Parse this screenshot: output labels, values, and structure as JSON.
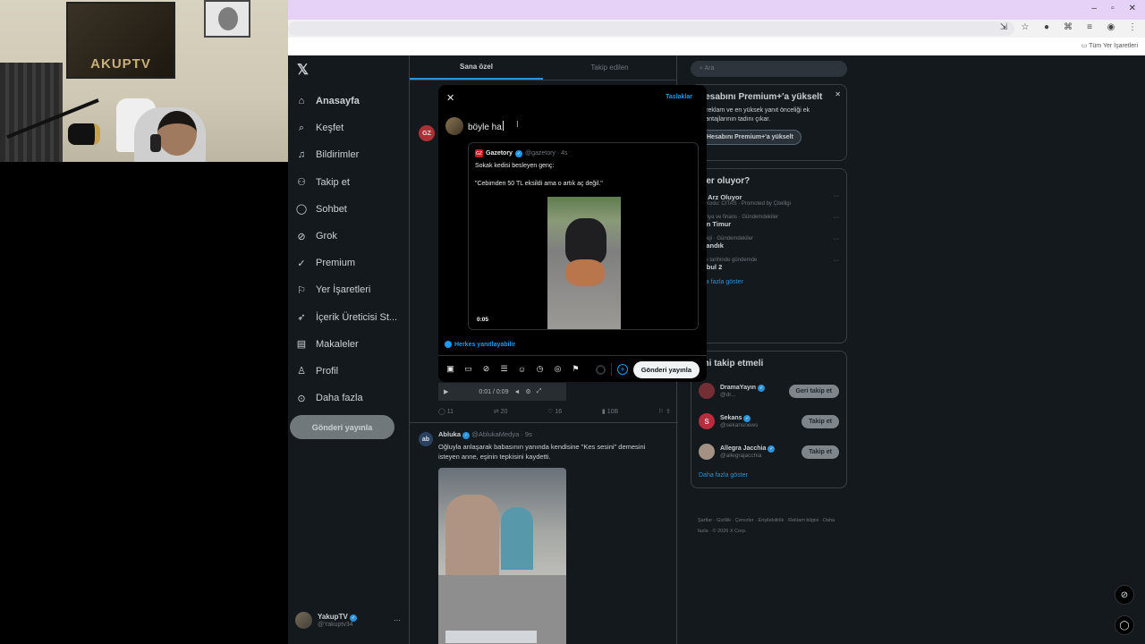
{
  "webcam": {
    "poster_text": "AKUPTV"
  },
  "window": {
    "minimize": "–",
    "maximize": "▫",
    "close": "✕"
  },
  "bookmarks": {
    "all_label": "Tüm Yer İşaretleri"
  },
  "sidebar": {
    "items": [
      {
        "label": "Anasayfa",
        "icon": "home-icon"
      },
      {
        "label": "Keşfet",
        "icon": "search-icon"
      },
      {
        "label": "Bildirimler",
        "icon": "bell-icon"
      },
      {
        "label": "Takip et",
        "icon": "follow-icon"
      },
      {
        "label": "Sohbet",
        "icon": "chat-icon"
      },
      {
        "label": "Grok",
        "icon": "grok-icon"
      },
      {
        "label": "Premium",
        "icon": "premium-icon"
      },
      {
        "label": "Yer İşaretleri",
        "icon": "bookmark-icon"
      },
      {
        "label": "İçerik Üreticisi St...",
        "icon": "rocket-icon"
      },
      {
        "label": "Makaleler",
        "icon": "article-icon"
      },
      {
        "label": "Profil",
        "icon": "profile-icon"
      },
      {
        "label": "Daha fazla",
        "icon": "more-icon"
      }
    ],
    "post_button": "Gönderi yayınla",
    "account": {
      "name": "YakupTV",
      "handle": "@Yakuptv34"
    }
  },
  "main": {
    "tabs": [
      "Sana özel",
      "Takip edilen"
    ],
    "video_time": "0:01 / 0:09",
    "actions": [
      "11",
      "20",
      "16",
      "10B"
    ],
    "post2": {
      "name": "Abluka",
      "handle": "@AblukaMedya · 9s",
      "text": "Oğluyla anlaşarak babasının yanında kendisine \"Kes sesini\" demesini isteyen anne, eşinin tepkisini kaydetti."
    }
  },
  "modal": {
    "drafts": "Taslaklar",
    "text": "böyle ha",
    "quote": {
      "name": "Gazetory",
      "handle": "@gazetory · 4s",
      "line1": "Sokak kedisi besleyen genç:",
      "line2": "\"Cebimden 50 TL eksildi ama o artık aç değil.\"",
      "duration": "0:05"
    },
    "reply_setting": "Herkes yanıtlayabilir",
    "send_button": "Gönderi yayınla"
  },
  "right": {
    "search_placeholder": "Ara",
    "premium": {
      "title": "Hesabını Premium+'a yükselt",
      "desc": "fır reklam ve en yüksek yanıt önceliği ek avantajlarının tadını çıkar.",
      "button": "Hesabını Premium+'a yükselt"
    },
    "trends_title": "eler oluyor?",
    "trends": [
      {
        "meta": "",
        "name": "ka Arz Oluyor",
        "sub": "ve Kodu: CITAS · Promoted by Çitelligi"
      },
      {
        "meta": "Dünya ve finans · Gündemdekiler",
        "name": "den Timur",
        "sub": ""
      },
      {
        "meta": "ikoloji · Gündemdekiler",
        "name": "allandık",
        "sub": ""
      },
      {
        "meta": "kiye tarihinde gündemde",
        "name": "anbul 2",
        "sub": ""
      }
    ],
    "show_more": "aha fazla göster",
    "follow_title": "imi takip etmeli",
    "follow": [
      {
        "name": "DramaYayın",
        "handle": "@dr...",
        "button": "Geri takip et",
        "color": "#7a1d1d",
        "initial": ""
      },
      {
        "name": "Sekans",
        "handle": "@sekansnews",
        "button": "Takip et",
        "color": "#d3192b",
        "initial": "S"
      },
      {
        "name": "Allegra Jacchia",
        "handle": "@allegrajacchia",
        "button": "Takip et",
        "color": "#b89a84",
        "initial": ""
      }
    ],
    "follow_more": "Daha fazla göster",
    "footer": "Şartlar · Gizlilik · Çerezler · Erişilebilirlik · Reklam bilgisi · Daha fazla · © 2026 X Corp."
  }
}
